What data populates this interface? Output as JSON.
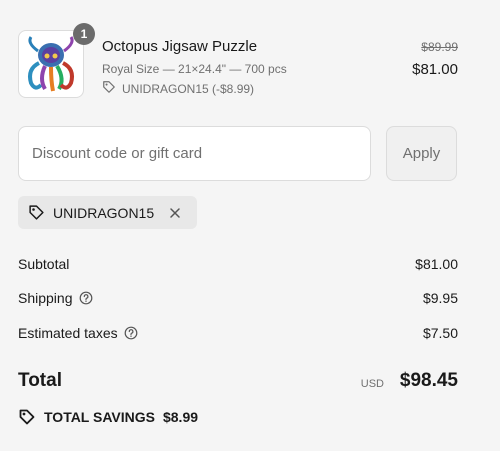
{
  "line_item": {
    "quantity": "1",
    "title": "Octopus Jigsaw Puzzle",
    "variant": "Royal Size — 21×24.4\" — 700 pcs",
    "discount_line": "UNIDRAGON15 (-$8.99)",
    "price_original": "$89.99",
    "price_current": "$81.00",
    "thumbnail_icon": "octopus-puzzle-image"
  },
  "discount_form": {
    "placeholder": "Discount code or gift card",
    "apply_label": "Apply"
  },
  "applied_code": {
    "code": "UNIDRAGON15"
  },
  "summary": {
    "subtotal_label": "Subtotal",
    "subtotal_value": "$81.00",
    "shipping_label": "Shipping",
    "shipping_value": "$9.95",
    "taxes_label": "Estimated taxes",
    "taxes_value": "$7.50",
    "total_label": "Total",
    "currency": "USD",
    "total_value": "$98.45",
    "savings_label": "TOTAL SAVINGS",
    "savings_value": "$8.99"
  },
  "colors": {
    "background": "#f5f5f5",
    "text": "#1a1a1a",
    "muted": "#707070",
    "border": "#dcdcdc"
  }
}
